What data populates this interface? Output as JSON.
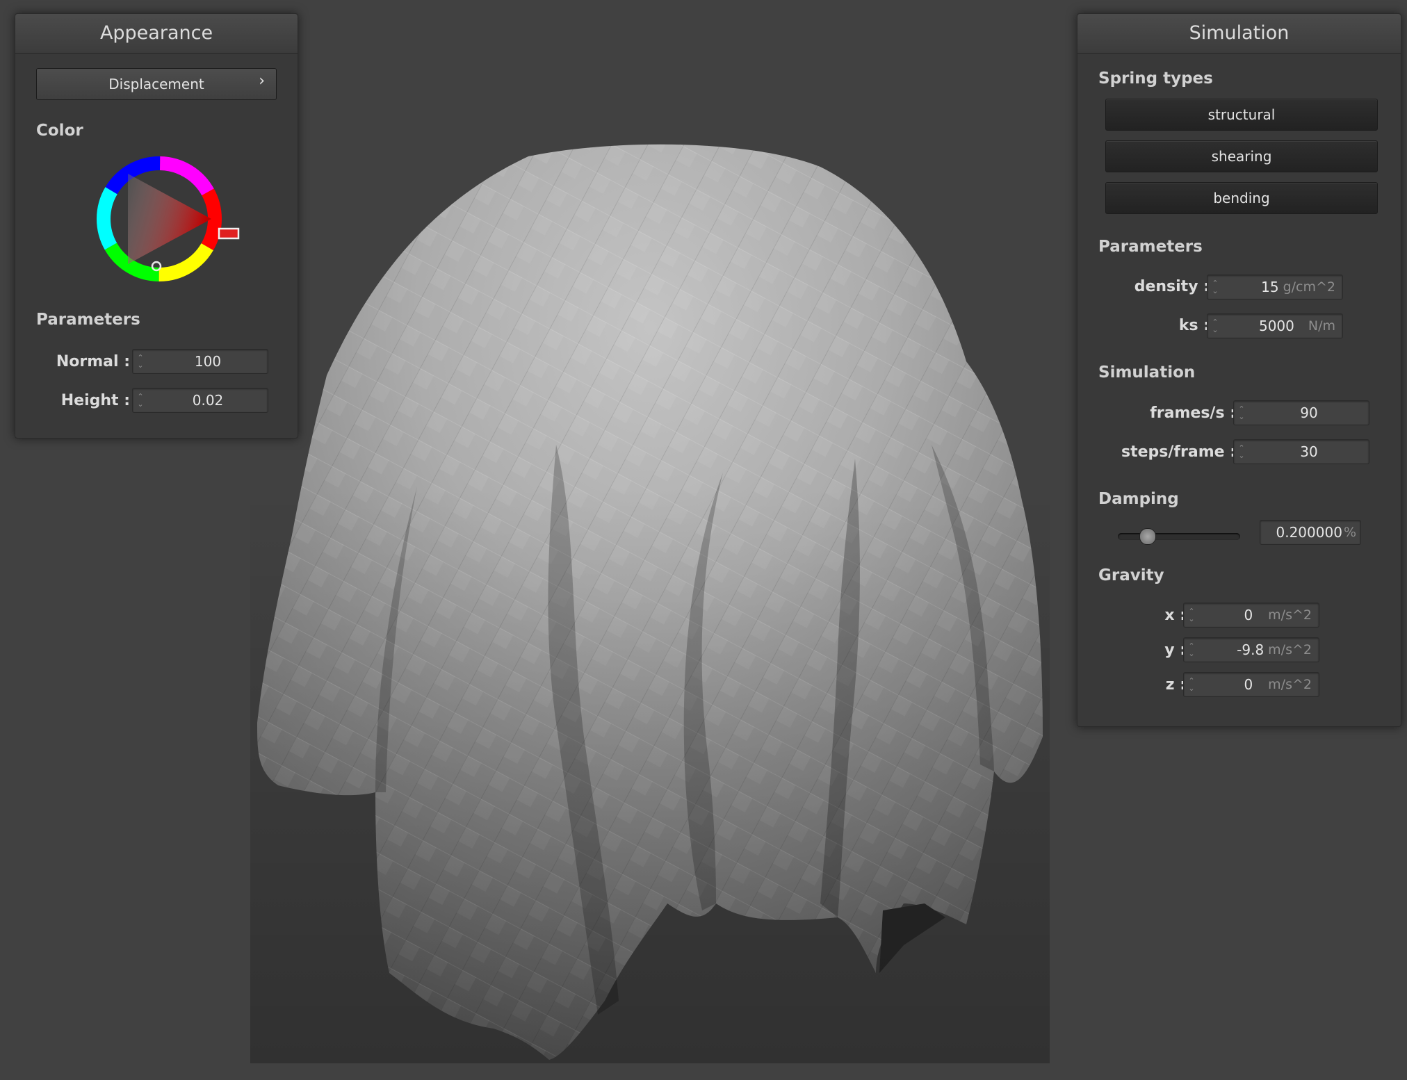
{
  "appearance": {
    "title": "Appearance",
    "displacement_label": "Displacement",
    "displacement_chevron": "›",
    "color_label": "Color",
    "color_value": "#ff0000",
    "parameters_label": "Parameters",
    "normal_label": "Normal :",
    "normal_value": "100",
    "height_label": "Height :",
    "height_value": "0.02"
  },
  "simulation": {
    "title": "Simulation",
    "spring_types_label": "Spring types",
    "springs": [
      "structural",
      "shearing",
      "bending"
    ],
    "parameters_label": "Parameters",
    "density_label": "density :",
    "density_value": "15",
    "density_unit": "g/cm^2",
    "ks_label": "ks :",
    "ks_value": "5000",
    "ks_unit": "N/m",
    "simulation_label": "Simulation",
    "fps_label": "frames/s :",
    "fps_value": "90",
    "steps_label": "steps/frame :",
    "steps_value": "30",
    "damping_label": "Damping",
    "damping_value": "0.200000",
    "damping_unit": "%",
    "damping_slider_fraction": 0.2,
    "gravity_label": "Gravity",
    "gx_label": "x :",
    "gx_value": "0",
    "gx_unit": "m/s^2",
    "gy_label": "y :",
    "gy_value": "-9.8",
    "gy_unit": "m/s^2",
    "gz_label": "z :",
    "gz_value": "0",
    "gz_unit": "m/s^2"
  },
  "icons": {
    "spinner": "up-down-arrows-icon",
    "chevron": "chevron-right-icon"
  }
}
